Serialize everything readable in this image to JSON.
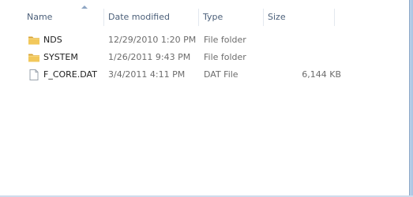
{
  "columns": {
    "name": "Name",
    "date_modified": "Date modified",
    "type": "Type",
    "size": "Size"
  },
  "sort": {
    "column": "name",
    "direction": "ascending",
    "indicator_color": "#8ea6c3"
  },
  "files": [
    {
      "name": "NDS",
      "date_modified": "12/29/2010 1:20 PM",
      "type": "File folder",
      "size": "",
      "icon": "folder-icon"
    },
    {
      "name": "SYSTEM",
      "date_modified": "1/26/2011 9:43 PM",
      "type": "File folder",
      "size": "",
      "icon": "folder-icon"
    },
    {
      "name": "F_CORE.DAT",
      "date_modified": "3/4/2011 4:11 PM",
      "type": "DAT File",
      "size": "6,144 KB",
      "icon": "file-icon"
    }
  ],
  "colors": {
    "header_text": "#4c607a",
    "folder_yellow": "#e9b94a",
    "frame_blue": "#b9d1ea"
  }
}
